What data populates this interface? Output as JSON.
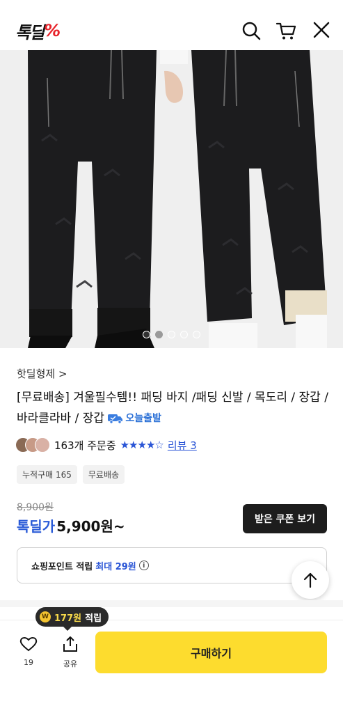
{
  "header": {
    "logo_text": "톡딜",
    "logo_mark": "%",
    "icons": [
      "search-icon",
      "cart-icon",
      "close-icon"
    ]
  },
  "gallery": {
    "total_images": 5,
    "current_index": 2
  },
  "product": {
    "seller": "핫딜형제 >",
    "title": "[무료배송] 겨울필수템!! 패딩 바지 /패딩 신발 / 목도리 / 장갑 / 바라클라바 / 장갑",
    "delivery_badge": "오늘출발",
    "order_count": "163개 주문중",
    "rating_stars": "★★★★",
    "rating_half": "☆",
    "review_link": "리뷰 3",
    "chips": [
      "누적구매 165",
      "무료배송"
    ],
    "original_price": "8,900원",
    "price_label": "톡딜가",
    "price_value": "5,900원~",
    "coupon_button": "받은 쿠폰 보기"
  },
  "points": {
    "label": "쇼핑포인트 적립",
    "max_text": "최대 29원"
  },
  "bottom": {
    "reward_amount": "177원",
    "reward_suffix": "적립",
    "like_count": "19",
    "share_label": "공유",
    "buy_label": "구매하기"
  },
  "colors": {
    "accent_blue": "#2a55d6",
    "buy_yellow": "#fddc2e",
    "logo_red": "#e8242b"
  }
}
